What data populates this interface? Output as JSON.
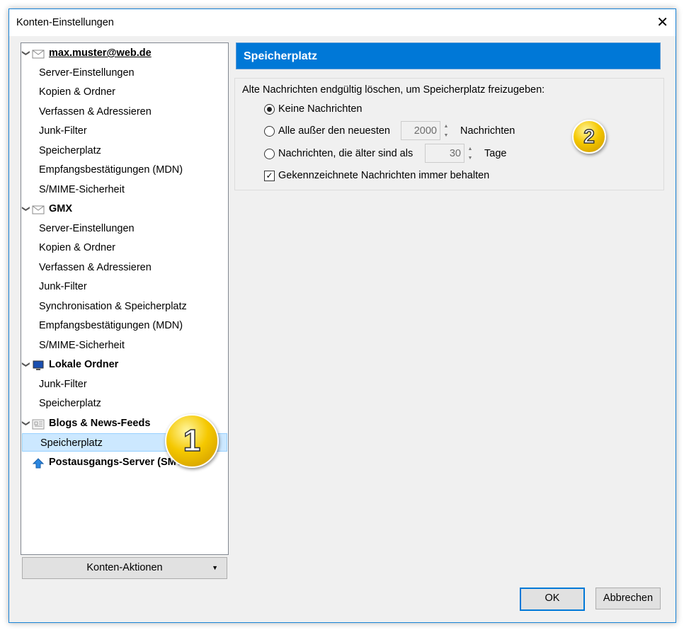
{
  "window": {
    "title": "Konten-Einstellungen",
    "close": "✕"
  },
  "tree": [
    {
      "type": "root",
      "label": "max.muster@web.de",
      "icon": "mail-icon",
      "underline": true
    },
    {
      "type": "child",
      "label": "Server-Einstellungen"
    },
    {
      "type": "child",
      "label": "Kopien & Ordner"
    },
    {
      "type": "child",
      "label": "Verfassen & Adressieren"
    },
    {
      "type": "child",
      "label": "Junk-Filter"
    },
    {
      "type": "child",
      "label": "Speicherplatz"
    },
    {
      "type": "child",
      "label": "Empfangsbestätigungen (MDN)"
    },
    {
      "type": "child",
      "label": "S/MIME-Sicherheit"
    },
    {
      "type": "root",
      "label": "GMX",
      "icon": "mail-icon"
    },
    {
      "type": "child",
      "label": "Server-Einstellungen"
    },
    {
      "type": "child",
      "label": "Kopien & Ordner"
    },
    {
      "type": "child",
      "label": "Verfassen & Adressieren"
    },
    {
      "type": "child",
      "label": "Junk-Filter"
    },
    {
      "type": "child",
      "label": "Synchronisation & Speicherplatz"
    },
    {
      "type": "child",
      "label": "Empfangsbestätigungen (MDN)"
    },
    {
      "type": "child",
      "label": "S/MIME-Sicherheit"
    },
    {
      "type": "root",
      "label": "Lokale Ordner",
      "icon": "computer-icon"
    },
    {
      "type": "child",
      "label": "Junk-Filter"
    },
    {
      "type": "child",
      "label": "Speicherplatz"
    },
    {
      "type": "root",
      "label": "Blogs & News-Feeds",
      "icon": "newspaper-icon"
    },
    {
      "type": "child",
      "label": "Speicherplatz",
      "selected": true
    },
    {
      "type": "root",
      "label": "Postausgangs-Server (SMTP)",
      "icon": "outbox-icon",
      "nochev": true
    }
  ],
  "account_actions": "Konten-Aktionen",
  "panel": {
    "title": "Speicherplatz",
    "intro": "Alte Nachrichten endgültig löschen, um Speicherplatz freizugeben:",
    "opt_none": "Keine Nachrichten",
    "opt_none_selected": true,
    "opt_keep_pre": "Alle außer den neuesten",
    "keep_count": "2000",
    "keep_unit": "Nachrichten",
    "opt_older_pre": "Nachrichten, die älter sind als",
    "older_days": "30",
    "older_unit": "Tage",
    "keep_flagged": "Gekennzeichnete Nachrichten immer behalten",
    "keep_flagged_checked": true
  },
  "buttons": {
    "ok": "OK",
    "cancel": "Abbrechen"
  },
  "markers": {
    "one": "1",
    "two": "2"
  },
  "colors": {
    "accent": "#0078d7",
    "selection": "#cce8ff"
  }
}
